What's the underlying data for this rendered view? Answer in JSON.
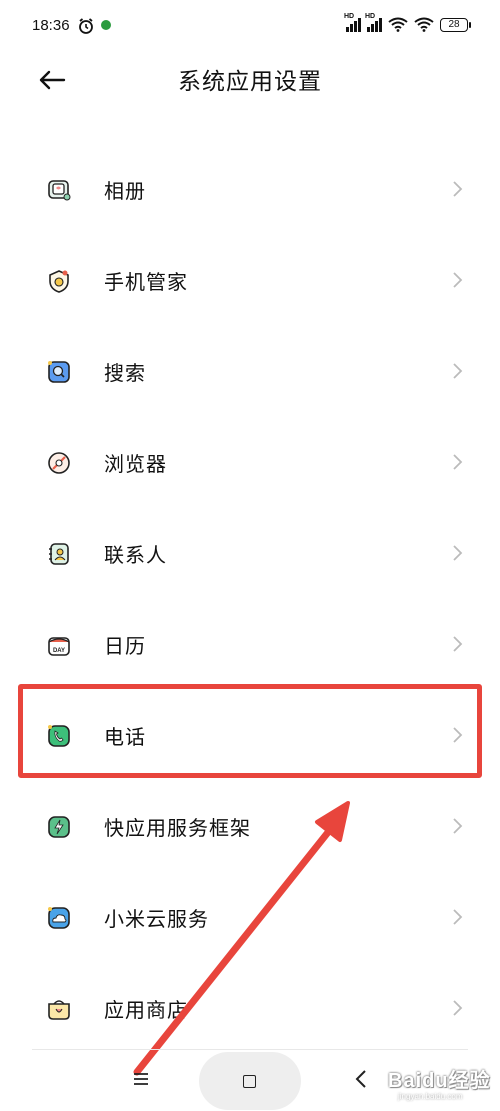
{
  "status_bar": {
    "time": "18:36",
    "battery": "28",
    "icons": [
      "alarm-icon",
      "app-notification-icon",
      "signal-hd-icon",
      "signal-hd-icon",
      "wifi-icon",
      "wifi-icon",
      "battery-icon"
    ]
  },
  "header": {
    "back_icon": "back-arrow-icon",
    "title": "系统应用设置"
  },
  "settings": {
    "items": [
      {
        "label": "相册",
        "icon": "gallery-icon"
      },
      {
        "label": "手机管家",
        "icon": "security-icon"
      },
      {
        "label": "搜索",
        "icon": "search-icon"
      },
      {
        "label": "浏览器",
        "icon": "browser-icon"
      },
      {
        "label": "联系人",
        "icon": "contacts-icon"
      },
      {
        "label": "日历",
        "icon": "calendar-icon",
        "icon_text": "DAY"
      },
      {
        "label": "电话",
        "icon": "phone-icon",
        "highlighted": true
      },
      {
        "label": "快应用服务框架",
        "icon": "quick-app-icon"
      },
      {
        "label": "小米云服务",
        "icon": "cloud-icon"
      },
      {
        "label": "应用商店",
        "icon": "app-store-icon"
      }
    ]
  },
  "annotation": {
    "highlight_color": "#e8453c",
    "arrow_color": "#e8453c"
  },
  "nav_bar": {
    "icons": [
      "menu-icon",
      "home-icon",
      "back-icon"
    ]
  },
  "watermark": {
    "text": "Baidu经验",
    "sub": "jingyan.baidu.com"
  }
}
